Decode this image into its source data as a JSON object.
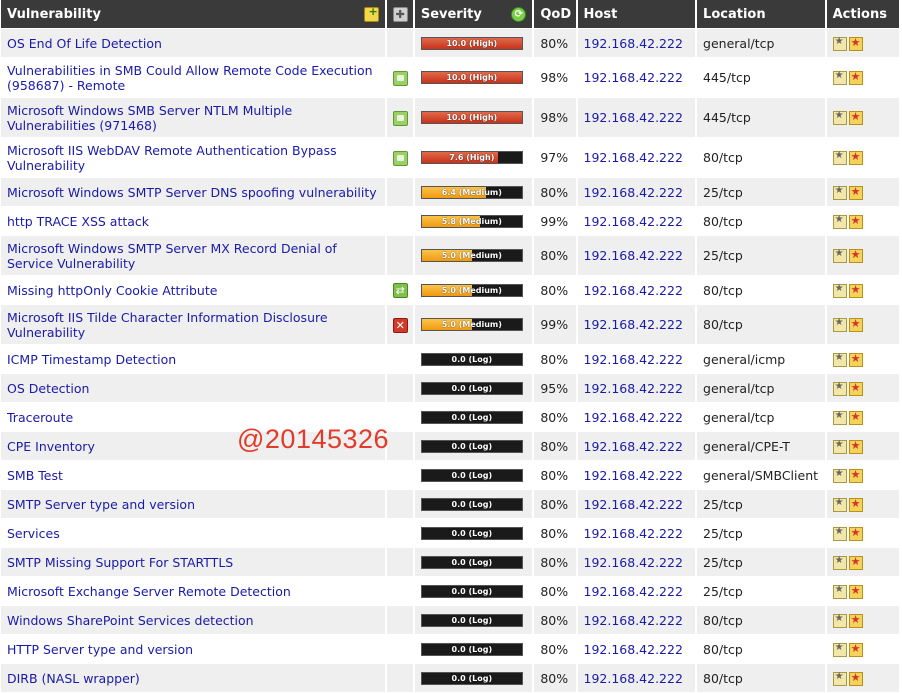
{
  "header": {
    "vulnerability": "Vulnerability",
    "severity": "Severity",
    "qod": "QoD",
    "host": "Host",
    "location": "Location",
    "actions": "Actions"
  },
  "header_icons": {
    "add_filter": "new-note-icon",
    "puzzle": "puzzle-icon",
    "refresh": "refresh-icon"
  },
  "watermark": "@20145326",
  "rows": [
    {
      "name": "OS End Of Life Detection",
      "icon": "",
      "sev_label": "10.0 (High)",
      "sev_value": 10.0,
      "level": "high",
      "qod": "80%",
      "host": "192.168.42.222",
      "location": "general/tcp"
    },
    {
      "name": "Vulnerabilities in SMB Could Allow Remote Code Execution (958687) - Remote",
      "icon": "note",
      "sev_label": "10.0 (High)",
      "sev_value": 10.0,
      "level": "high",
      "qod": "98%",
      "host": "192.168.42.222",
      "location": "445/tcp"
    },
    {
      "name": "Microsoft Windows SMB Server NTLM Multiple Vulnerabilities (971468)",
      "icon": "note",
      "sev_label": "10.0 (High)",
      "sev_value": 10.0,
      "level": "high",
      "qod": "98%",
      "host": "192.168.42.222",
      "location": "445/tcp"
    },
    {
      "name": "Microsoft IIS WebDAV Remote Authentication Bypass Vulnerability",
      "icon": "note",
      "sev_label": "7.6 (High)",
      "sev_value": 7.6,
      "level": "high",
      "qod": "97%",
      "host": "192.168.42.222",
      "location": "80/tcp"
    },
    {
      "name": "Microsoft Windows SMTP Server DNS spoofing vulnerability",
      "icon": "",
      "sev_label": "6.4 (Medium)",
      "sev_value": 6.4,
      "level": "medium",
      "qod": "80%",
      "host": "192.168.42.222",
      "location": "25/tcp"
    },
    {
      "name": "http TRACE XSS attack",
      "icon": "",
      "sev_label": "5.8 (Medium)",
      "sev_value": 5.8,
      "level": "medium",
      "qod": "99%",
      "host": "192.168.42.222",
      "location": "80/tcp"
    },
    {
      "name": "Microsoft Windows SMTP Server MX Record Denial of Service Vulnerability",
      "icon": "",
      "sev_label": "5.0 (Medium)",
      "sev_value": 5.0,
      "level": "medium",
      "qod": "80%",
      "host": "192.168.42.222",
      "location": "25/tcp"
    },
    {
      "name": "Missing httpOnly Cookie Attribute",
      "icon": "override",
      "sev_label": "5.0 (Medium)",
      "sev_value": 5.0,
      "level": "medium",
      "qod": "80%",
      "host": "192.168.42.222",
      "location": "80/tcp"
    },
    {
      "name": "Microsoft IIS Tilde Character Information Disclosure Vulnerability",
      "icon": "false",
      "sev_label": "5.0 (Medium)",
      "sev_value": 5.0,
      "level": "medium",
      "qod": "99%",
      "host": "192.168.42.222",
      "location": "80/tcp"
    },
    {
      "name": "ICMP Timestamp Detection",
      "icon": "",
      "sev_label": "0.0 (Log)",
      "sev_value": 0,
      "level": "log",
      "qod": "80%",
      "host": "192.168.42.222",
      "location": "general/icmp"
    },
    {
      "name": "OS Detection",
      "icon": "",
      "sev_label": "0.0 (Log)",
      "sev_value": 0,
      "level": "log",
      "qod": "95%",
      "host": "192.168.42.222",
      "location": "general/tcp"
    },
    {
      "name": "Traceroute",
      "icon": "",
      "sev_label": "0.0 (Log)",
      "sev_value": 0,
      "level": "log",
      "qod": "80%",
      "host": "192.168.42.222",
      "location": "general/tcp"
    },
    {
      "name": "CPE Inventory",
      "icon": "",
      "sev_label": "0.0 (Log)",
      "sev_value": 0,
      "level": "log",
      "qod": "80%",
      "host": "192.168.42.222",
      "location": "general/CPE-T"
    },
    {
      "name": "SMB Test",
      "icon": "",
      "sev_label": "0.0 (Log)",
      "sev_value": 0,
      "level": "log",
      "qod": "80%",
      "host": "192.168.42.222",
      "location": "general/SMBClient"
    },
    {
      "name": "SMTP Server type and version",
      "icon": "",
      "sev_label": "0.0 (Log)",
      "sev_value": 0,
      "level": "log",
      "qod": "80%",
      "host": "192.168.42.222",
      "location": "25/tcp"
    },
    {
      "name": "Services",
      "icon": "",
      "sev_label": "0.0 (Log)",
      "sev_value": 0,
      "level": "log",
      "qod": "80%",
      "host": "192.168.42.222",
      "location": "25/tcp"
    },
    {
      "name": "SMTP Missing Support For STARTTLS",
      "icon": "",
      "sev_label": "0.0 (Log)",
      "sev_value": 0,
      "level": "log",
      "qod": "80%",
      "host": "192.168.42.222",
      "location": "25/tcp"
    },
    {
      "name": "Microsoft Exchange Server Remote Detection",
      "icon": "",
      "sev_label": "0.0 (Log)",
      "sev_value": 0,
      "level": "log",
      "qod": "80%",
      "host": "192.168.42.222",
      "location": "25/tcp"
    },
    {
      "name": "Windows SharePoint Services detection",
      "icon": "",
      "sev_label": "0.0 (Log)",
      "sev_value": 0,
      "level": "log",
      "qod": "80%",
      "host": "192.168.42.222",
      "location": "80/tcp"
    },
    {
      "name": "HTTP Server type and version",
      "icon": "",
      "sev_label": "0.0 (Log)",
      "sev_value": 0,
      "level": "log",
      "qod": "80%",
      "host": "192.168.42.222",
      "location": "80/tcp"
    },
    {
      "name": "DIRB (NASL wrapper)",
      "icon": "",
      "sev_label": "0.0 (Log)",
      "sev_value": 0,
      "level": "log",
      "qod": "80%",
      "host": "192.168.42.222",
      "location": "80/tcp"
    }
  ],
  "colors": {
    "header_bg": "#3a3a3a",
    "link": "#1a1aa8",
    "high": "#c8321a",
    "medium": "#f09a10",
    "log_bar": "#1a1a1a",
    "watermark": "#e23b2a"
  }
}
